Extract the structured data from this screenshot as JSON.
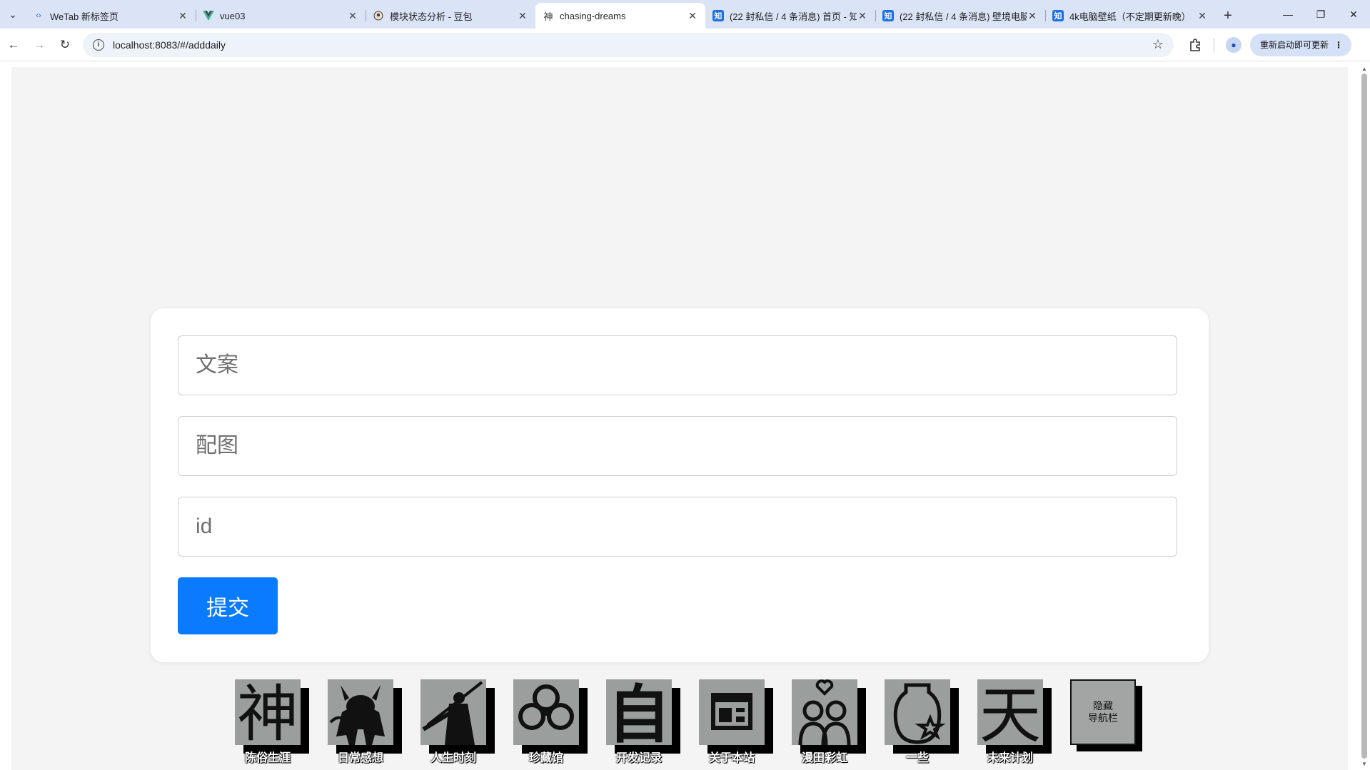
{
  "browser": {
    "tabs": [
      {
        "label": "WeTab 新标签页",
        "favicon": "wetab-icon",
        "active": false
      },
      {
        "label": "vue03",
        "favicon": "vue-icon",
        "active": false
      },
      {
        "label": "模块状态分析 - 豆包",
        "favicon": "doubao-icon",
        "active": false
      },
      {
        "label": "chasing-dreams",
        "favicon": "shen-icon",
        "active": true
      },
      {
        "label": "(22 封私信 / 4 条消息) 首页 - 知",
        "favicon": "zhihu-icon",
        "active": false
      },
      {
        "label": "(22 封私信 / 4 条消息) 壁境电脑",
        "favicon": "zhihu-icon",
        "active": false
      },
      {
        "label": "4k电脑壁纸（不定期更新晚）",
        "favicon": "zhihu-icon",
        "active": false
      }
    ],
    "zhihu_favicon_text": "知",
    "shen_favicon_text": "神",
    "new_tab_symbol": "+",
    "url": "localhost:8083/#/adddaily",
    "update_label": "重新启动即可更新"
  },
  "form": {
    "copy_placeholder": "文案",
    "image_placeholder": "配图",
    "id_placeholder": "id",
    "submit_label": "提交"
  },
  "nav": {
    "items": [
      {
        "label": "陈俗生涯",
        "icon": "shen-calligraphy-icon"
      },
      {
        "label": "日常感想",
        "icon": "demon-figure-icon"
      },
      {
        "label": "人生时刻",
        "icon": "warrior-figure-icon"
      },
      {
        "label": "珍藏馆",
        "icon": "clover-knot-icon"
      },
      {
        "label": "开发记录",
        "icon": "zi-calligraphy-icon"
      },
      {
        "label": "关于本站",
        "icon": "layout-window-icon"
      },
      {
        "label": "漫田彩虹",
        "icon": "couple-heart-icon"
      },
      {
        "label": "一些",
        "icon": "jar-star-icon"
      },
      {
        "label": "未来计划",
        "icon": "tian-calligraphy-icon"
      }
    ],
    "hide_label_line1": "隐藏",
    "hide_label_line2": "导航栏"
  },
  "colors": {
    "accent": "#0a7bff",
    "page_bg": "#f4f4f4",
    "tile_bg": "#9a9e9d",
    "tabbar_bg": "#dbe4f7"
  }
}
